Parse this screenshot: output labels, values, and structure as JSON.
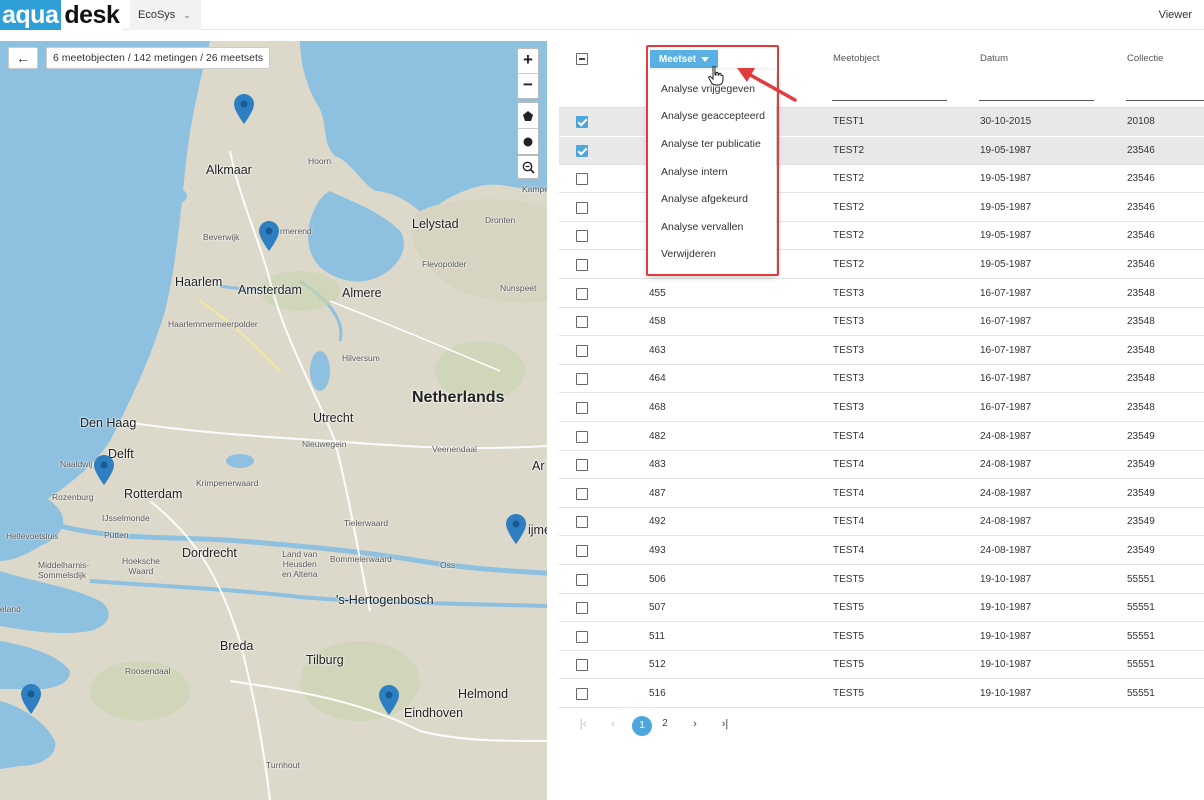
{
  "header": {
    "logo_aqua": "aqua",
    "logo_desk": "desk",
    "app_name": "EcoSys",
    "role": "Viewer"
  },
  "map": {
    "counts_text": "6 meetobjecten / 142 metingen  / 26 meetsets",
    "zoom_in": "+",
    "zoom_out": "−",
    "places": {
      "alkmaar": "Alkmaar",
      "hoorn": "Hoorn",
      "lelystad": "Lelystad",
      "dronten": "Dronten",
      "kampen": "Kampe",
      "beverwijk": "Beverwijk",
      "purmerend": "rmerend",
      "haarlem": "Haarlem",
      "amsterdam": "Amsterdam",
      "almere": "Almere",
      "flevopolder": "Flevopolder",
      "nunspeet": "Nunspeet",
      "haarlemmermeer": "Haarlemmermeerpolder",
      "hilversum": "Hilversum",
      "netherlands": "Netherlands",
      "den_haag": "Den Haag",
      "utrecht": "Utrecht",
      "nieuwegein": "Nieuwegein",
      "delft": "Delft",
      "naaldwijk": "Naaldwij",
      "veenendaal": "Veenendaal",
      "arnhem": "Ar",
      "rozenburg": "Rozenburg",
      "rotterdam": "Rotterdam",
      "krimpenerwaard": "Krimpenerwaard",
      "ijsselmonde": "IJsselmonde",
      "hellevoetsluis": "Hellevoetsluis",
      "putten": "Putten",
      "tielerwaard": "Tielerwaard",
      "nijmegen": "ijme",
      "dordrecht": "Dordrecht",
      "hoeksche_waard": "Hoeksche\nWaard",
      "land_van_heusden": "Land van\nHeusden\nen Altena",
      "bommelerwaard": "Bommelerwaard",
      "oss": "Oss",
      "middelharnis": "Middelharnis-\nSommelsdijk",
      "s_hertogenbosch": "'s-Hertogenbosch",
      "zeeland": "eland",
      "breda": "Breda",
      "tilburg": "Tilburg",
      "roosendaal": "Roosendaal",
      "helmond": "Helmond",
      "eindhoven": "Eindhoven",
      "turnhout": "Turnhout"
    }
  },
  "table": {
    "columns": {
      "meetset": "Meetset",
      "meetobject": "Meetobject",
      "datum": "Datum",
      "collectie": "Collectie"
    },
    "rows": [
      {
        "checked": true,
        "meetset": "",
        "meetobject": "TEST1",
        "datum": "30-10-2015",
        "collectie": "20108"
      },
      {
        "checked": true,
        "meetset": "",
        "meetobject": "TEST2",
        "datum": "19-05-1987",
        "collectie": "23546"
      },
      {
        "checked": false,
        "meetset": "",
        "meetobject": "TEST2",
        "datum": "19-05-1987",
        "collectie": "23546"
      },
      {
        "checked": false,
        "meetset": "",
        "meetobject": "TEST2",
        "datum": "19-05-1987",
        "collectie": "23546"
      },
      {
        "checked": false,
        "meetset": "",
        "meetobject": "TEST2",
        "datum": "19-05-1987",
        "collectie": "23546"
      },
      {
        "checked": false,
        "meetset": "",
        "meetobject": "TEST2",
        "datum": "19-05-1987",
        "collectie": "23546"
      },
      {
        "checked": false,
        "meetset": "455",
        "meetobject": "TEST3",
        "datum": "16-07-1987",
        "collectie": "23548"
      },
      {
        "checked": false,
        "meetset": "458",
        "meetobject": "TEST3",
        "datum": "16-07-1987",
        "collectie": "23548"
      },
      {
        "checked": false,
        "meetset": "463",
        "meetobject": "TEST3",
        "datum": "16-07-1987",
        "collectie": "23548"
      },
      {
        "checked": false,
        "meetset": "464",
        "meetobject": "TEST3",
        "datum": "16-07-1987",
        "collectie": "23548"
      },
      {
        "checked": false,
        "meetset": "468",
        "meetobject": "TEST3",
        "datum": "16-07-1987",
        "collectie": "23548"
      },
      {
        "checked": false,
        "meetset": "482",
        "meetobject": "TEST4",
        "datum": "24-08-1987",
        "collectie": "23549"
      },
      {
        "checked": false,
        "meetset": "483",
        "meetobject": "TEST4",
        "datum": "24-08-1987",
        "collectie": "23549"
      },
      {
        "checked": false,
        "meetset": "487",
        "meetobject": "TEST4",
        "datum": "24-08-1987",
        "collectie": "23549"
      },
      {
        "checked": false,
        "meetset": "492",
        "meetobject": "TEST4",
        "datum": "24-08-1987",
        "collectie": "23549"
      },
      {
        "checked": false,
        "meetset": "493",
        "meetobject": "TEST4",
        "datum": "24-08-1987",
        "collectie": "23549"
      },
      {
        "checked": false,
        "meetset": "506",
        "meetobject": "TEST5",
        "datum": "19-10-1987",
        "collectie": "55551"
      },
      {
        "checked": false,
        "meetset": "507",
        "meetobject": "TEST5",
        "datum": "19-10-1987",
        "collectie": "55551"
      },
      {
        "checked": false,
        "meetset": "511",
        "meetobject": "TEST5",
        "datum": "19-10-1987",
        "collectie": "55551"
      },
      {
        "checked": false,
        "meetset": "512",
        "meetobject": "TEST5",
        "datum": "19-10-1987",
        "collectie": "55551"
      },
      {
        "checked": false,
        "meetset": "516",
        "meetobject": "TEST5",
        "datum": "19-10-1987",
        "collectie": "55551"
      }
    ]
  },
  "dropdown": {
    "items": [
      "Analyse vrijgegeven",
      "Analyse geaccepteerd",
      "Analyse ter publicatie",
      "Analyse intern",
      "Analyse afgekeurd",
      "Analyse vervallen",
      "Verwijderen"
    ]
  },
  "pager": {
    "first": "|‹",
    "prev": "‹",
    "pages": [
      "1",
      "2"
    ],
    "current": "1",
    "next": "›",
    "last": "›|"
  },
  "colors": {
    "accent": "#4ea7dc",
    "water": "#8ec0df",
    "land": "#d9d6c8",
    "highlight": "#e23b3b",
    "marker": "#2d7fc1"
  }
}
